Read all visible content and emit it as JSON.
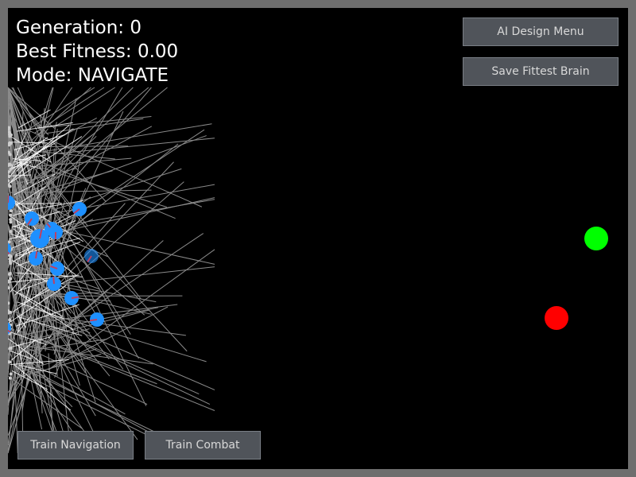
{
  "hud": {
    "generation_label": "Generation: 0",
    "fitness_label": "Best Fitness: 0.00",
    "mode_label": "Mode: NAVIGATE"
  },
  "buttons": {
    "ai_design_menu": "AI Design Menu",
    "save_fittest_brain": "Save Fittest Brain",
    "train_navigation": "Train Navigation",
    "train_combat": "Train Combat"
  },
  "colors": {
    "background": "#000000",
    "frame": "#6e6e6e",
    "agent": "#1e90ff",
    "agent_heading": "#c04060",
    "trail": "#ffffff",
    "ray": "#8a8a8a",
    "goal_target": "#00ff00",
    "hazard_target": "#ff0000",
    "button_bg": "#50545a",
    "button_text": "#d8d8d8"
  },
  "icons": {
    "goal": "green-goal-dot",
    "hazard": "red-hazard-dot",
    "agent": "blue-agent-circle"
  }
}
